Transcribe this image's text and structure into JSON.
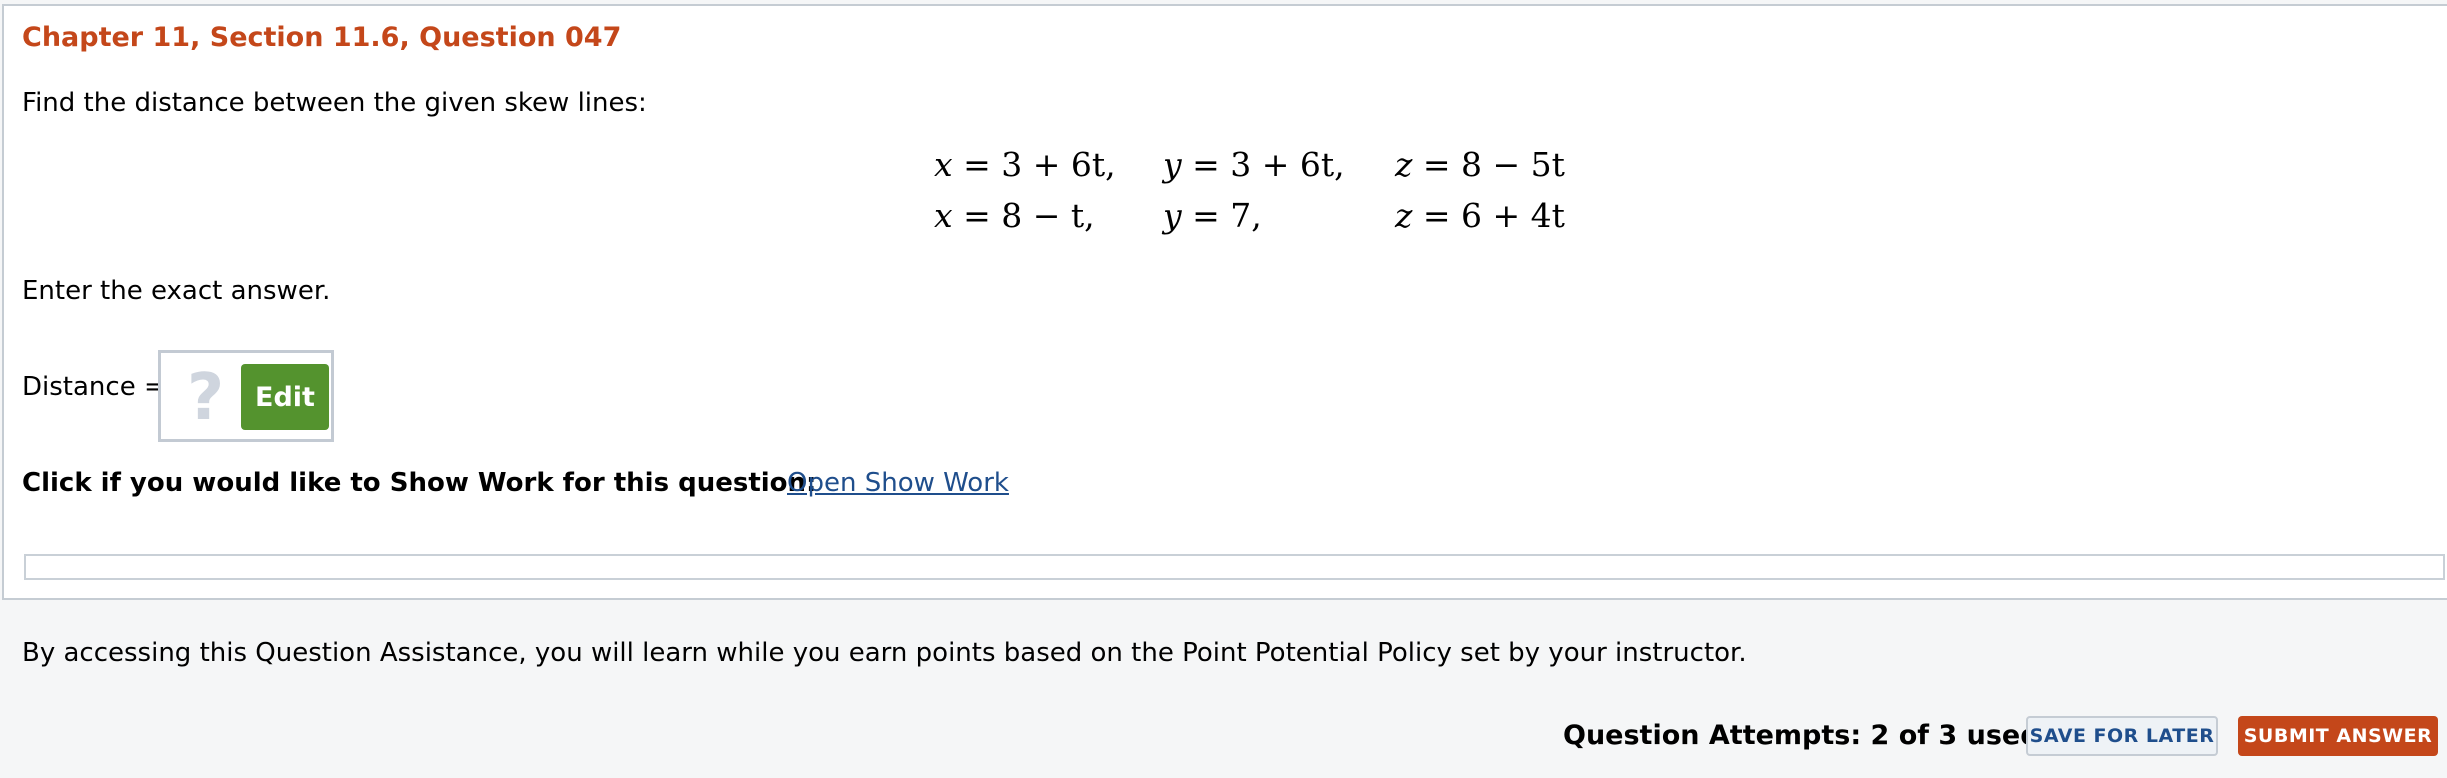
{
  "question": {
    "title": "Chapter 11, Section 11.6, Question 047",
    "prompt": "Find the distance between the given skew lines:",
    "instruction": "Enter the exact answer."
  },
  "equations": {
    "line1": {
      "x": {
        "var": "x",
        "expr": "= 3 + 6t,"
      },
      "y": {
        "var": "y",
        "expr": "= 3 + 6t,"
      },
      "z": {
        "var": "z",
        "expr": "= 8 − 5t"
      }
    },
    "line2": {
      "x": {
        "var": "x",
        "expr": "= 8 − t,"
      },
      "y": {
        "var": "y",
        "expr": "= 7,"
      },
      "z": {
        "var": "z",
        "expr": "= 6 + 4t"
      }
    }
  },
  "answer": {
    "label": "Distance =",
    "placeholder_symbol": "?",
    "edit_label": "Edit"
  },
  "show_work": {
    "prompt": "Click if you would like to Show Work for this question:",
    "link_label": "Open Show Work"
  },
  "assistance_text": "By accessing this Question Assistance, you will learn while you earn points based on the Point Potential Policy set by your instructor.",
  "footer": {
    "attempts": "Question Attempts: 2 of 3 used",
    "save_label": "SAVE FOR LATER",
    "submit_label": "SUBMIT ANSWER"
  },
  "colors": {
    "title": "#c4471a",
    "edit_button": "#54932e",
    "submit_button": "#c4471a",
    "link": "#1f4e8c"
  }
}
